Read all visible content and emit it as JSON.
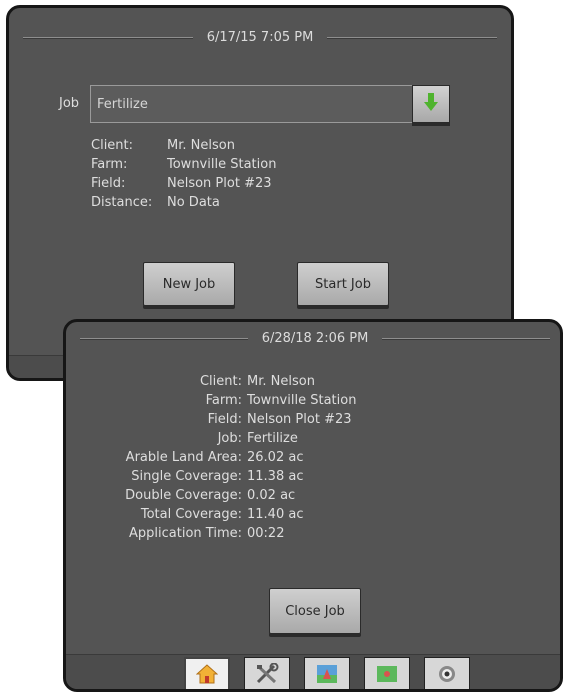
{
  "back_screen": {
    "timestamp": "6/17/15 7:05 PM",
    "job_label": "Job",
    "job_value": "Fertilize",
    "info": [
      {
        "key": "Client:",
        "value": "Mr. Nelson"
      },
      {
        "key": "Farm:",
        "value": "Townville Station"
      },
      {
        "key": "Field:",
        "value": "Nelson Plot #23"
      },
      {
        "key": "Distance:",
        "value": "No Data"
      }
    ],
    "new_job_label": "New Job",
    "start_job_label": "Start Job"
  },
  "front_screen": {
    "timestamp": "6/28/18 2:06 PM",
    "summary": [
      {
        "key": "Client:",
        "value": "Mr. Nelson"
      },
      {
        "key": "Farm:",
        "value": "Townville Station"
      },
      {
        "key": "Field:",
        "value": "Nelson Plot #23"
      },
      {
        "key": "Job:",
        "value": "Fertilize"
      },
      {
        "key": "Arable Land Area:",
        "value": "26.02 ac"
      },
      {
        "key": "Single Coverage:",
        "value": "11.38 ac"
      },
      {
        "key": "Double Coverage:",
        "value": "0.02 ac"
      },
      {
        "key": "Total Coverage:",
        "value": "11.40 ac"
      },
      {
        "key": "Application Time:",
        "value": "00:22"
      }
    ],
    "close_job_label": "Close Job",
    "tabs": [
      {
        "icon": "home-icon",
        "active": true
      },
      {
        "icon": "tools-icon",
        "active": false
      },
      {
        "icon": "vehicle-view-icon",
        "active": false
      },
      {
        "icon": "map-view-icon",
        "active": false
      },
      {
        "icon": "guidance-icon",
        "active": false
      }
    ]
  },
  "colors": {
    "screen_bg": "#545454",
    "bezel": "#161616",
    "arrow_green": "#4fb32e"
  }
}
